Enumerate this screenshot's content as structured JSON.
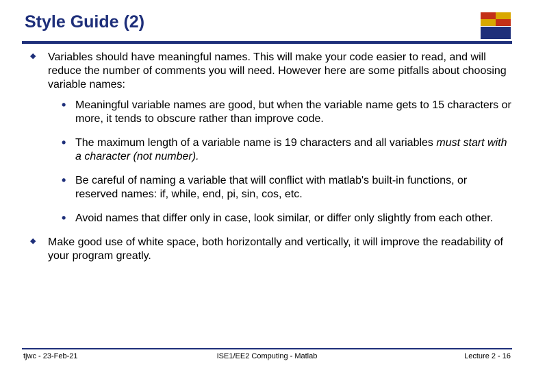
{
  "title": "Style Guide (2)",
  "bullets": {
    "b1": "Variables should have meaningful names. This will make your code easier to read, and will reduce the number of comments you will need. However here are some pitfalls about choosing variable names:",
    "b1s1": "Meaningful variable names are good, but when the variable name gets to 15 characters or more, it tends to obscure rather than improve code.",
    "b1s2a": "The maximum length of a variable name is 19 characters and all variables ",
    "b1s2b": "must start with a character (not number).",
    "b1s3": "Be careful of naming a variable that will conflict with matlab's built-in functions, or reserved names: if, while, end, pi, sin, cos, etc.",
    "b1s4": "Avoid names that differ only in case, look similar, or differ only slightly from each other.",
    "b2": "Make good use of white space, both horizontally and vertically, it will improve the readability of your program greatly."
  },
  "footer": {
    "left": "tjwc - 23-Feb-21",
    "center": "ISE1/EE2 Computing - Matlab",
    "right": "Lecture 2 - 16"
  }
}
